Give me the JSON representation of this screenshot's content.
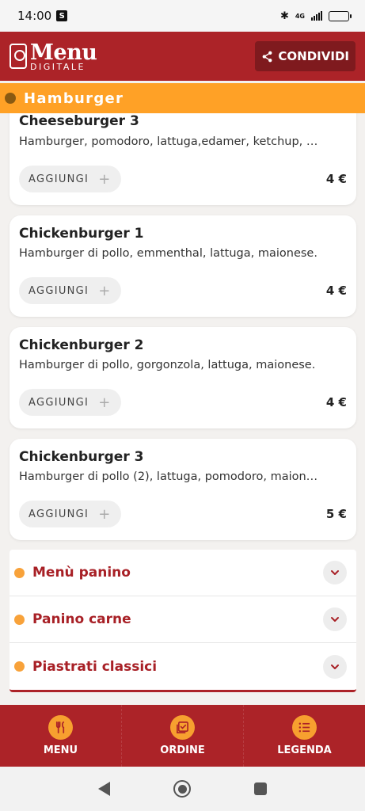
{
  "status_bar": {
    "time": "14:00",
    "network": "4G"
  },
  "header": {
    "logo_title": "Menu",
    "logo_subtitle": "DIGITALE",
    "share_label": "CONDIVIDI"
  },
  "section": {
    "title": "Hamburger"
  },
  "items": [
    {
      "name": "Cheeseburger 3",
      "description": "Hamburger, pomodoro, lattuga,edamer, ketchup, …",
      "add_label": "AGGIUNGI",
      "price": "4 €"
    },
    {
      "name": "Chickenburger 1",
      "description": "Hamburger di pollo, emmenthal, lattuga, maionese.",
      "add_label": "AGGIUNGI",
      "price": "4 €"
    },
    {
      "name": "Chickenburger 2",
      "description": "Hamburger di pollo, gorgonzola, lattuga, maionese.",
      "add_label": "AGGIUNGI",
      "price": "4 €"
    },
    {
      "name": "Chickenburger 3",
      "description": "Hamburger di pollo (2), lattuga, pomodoro, maion…",
      "add_label": "AGGIUNGI",
      "price": "5 €"
    }
  ],
  "categories": [
    {
      "label": "Menù panino"
    },
    {
      "label": "Panino carne"
    },
    {
      "label": "Piastrati classici"
    }
  ],
  "bottom_nav": [
    {
      "label": "MENU",
      "icon": "fork-knife-icon"
    },
    {
      "label": "ORDINE",
      "icon": "order-check-icon"
    },
    {
      "label": "LEGENDA",
      "icon": "list-icon"
    }
  ],
  "colors": {
    "brand_red": "#ac2328",
    "accent_orange": "#ffa126",
    "category_text": "#a82026"
  }
}
